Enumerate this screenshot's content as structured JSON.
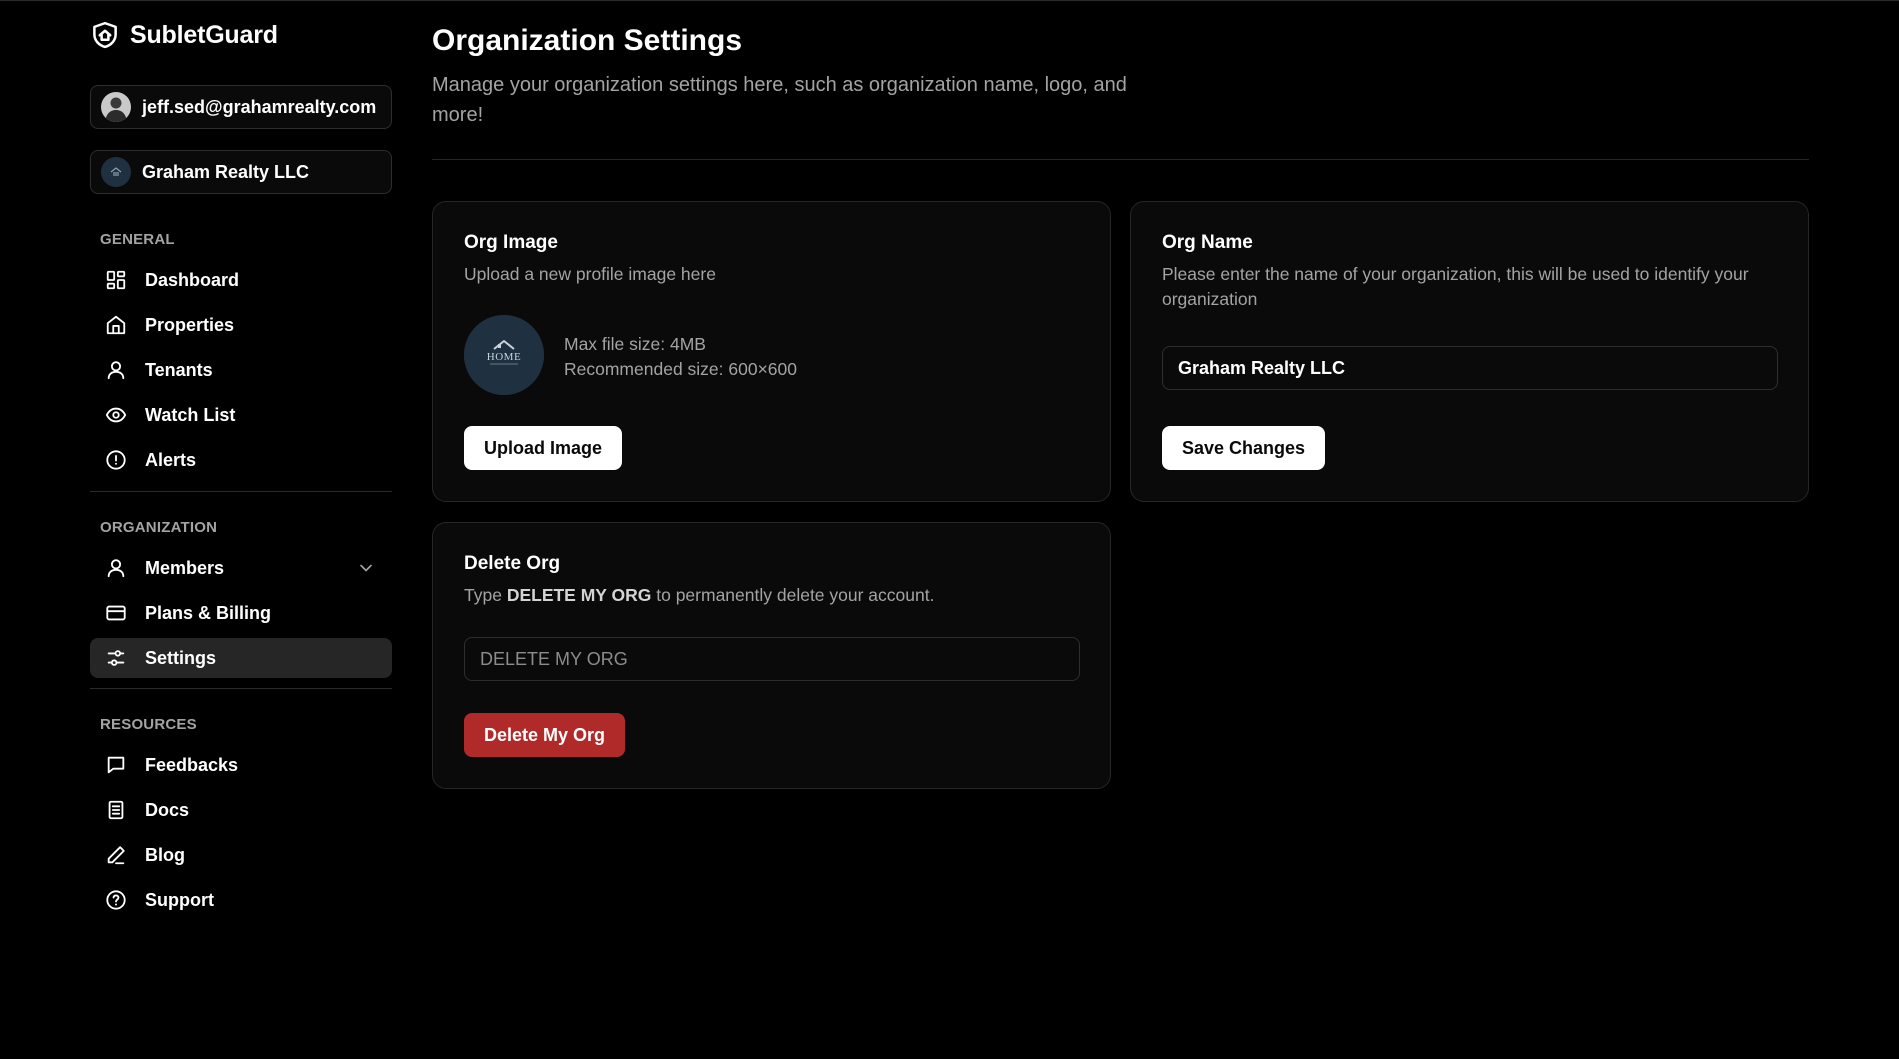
{
  "app": {
    "name": "SubletGuard",
    "brand_color": "#ffffff",
    "danger_color": "#b02a2a"
  },
  "sidebar": {
    "user_email": "jeff.sed@grahamrealty.com",
    "org_name": "Graham Realty LLC",
    "sections": {
      "general": "GENERAL",
      "organization": "ORGANIZATION",
      "resources": "RESOURCES"
    },
    "general_items": [
      {
        "label": "Dashboard",
        "icon": "dashboard-icon"
      },
      {
        "label": "Properties",
        "icon": "home-icon"
      },
      {
        "label": "Tenants",
        "icon": "user-icon"
      },
      {
        "label": "Watch List",
        "icon": "eye-icon"
      },
      {
        "label": "Alerts",
        "icon": "alert-circle-icon"
      }
    ],
    "organization_items": [
      {
        "label": "Members",
        "icon": "user-icon",
        "expandable": true
      },
      {
        "label": "Plans & Billing",
        "icon": "credit-card-icon"
      },
      {
        "label": "Settings",
        "icon": "sliders-icon",
        "active": true
      }
    ],
    "resource_items": [
      {
        "label": "Feedbacks",
        "icon": "message-square-icon"
      },
      {
        "label": "Docs",
        "icon": "document-icon"
      },
      {
        "label": "Blog",
        "icon": "pencil-icon"
      },
      {
        "label": "Support",
        "icon": "help-circle-icon"
      }
    ]
  },
  "main": {
    "title": "Organization Settings",
    "description": "Manage your organization settings here, such as organization name, logo, and more!",
    "org_image_card": {
      "title": "Org Image",
      "description": "Upload a new profile image here",
      "max_size": "Max file size: 4MB",
      "recommended_size": "Recommended size: 600×600",
      "logo_text": "HOME",
      "button_label": "Upload Image"
    },
    "org_name_card": {
      "title": "Org Name",
      "description": "Please enter the name of your organization, this will be used to identify your organization",
      "input_value": "Graham Realty LLC",
      "button_label": "Save Changes"
    },
    "delete_card": {
      "title": "Delete Org",
      "description_prefix": "Type ",
      "description_keyword": "DELETE MY ORG",
      "description_suffix": " to permanently delete your account.",
      "input_placeholder": "DELETE MY ORG",
      "button_label": "Delete My Org"
    }
  }
}
